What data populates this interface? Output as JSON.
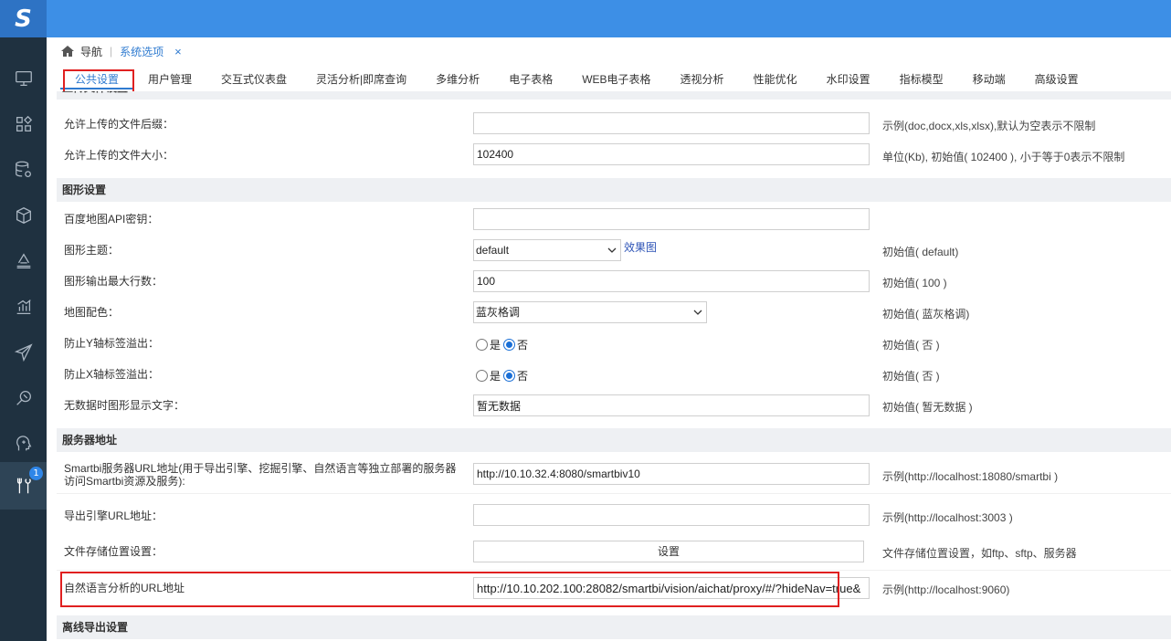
{
  "app": {
    "logo_glyph": "S",
    "colors": {
      "topbar": "#3d8fe6",
      "sidebar": "#1f3140",
      "accent": "#2f7bd0",
      "highlight": "#e02020"
    }
  },
  "sidebar": {
    "items": [
      {
        "icon": "monitor-icon"
      },
      {
        "icon": "widgets-icon"
      },
      {
        "icon": "database-settings-icon"
      },
      {
        "icon": "cube-icon"
      },
      {
        "icon": "layers-icon"
      },
      {
        "icon": "bar-chart-icon"
      },
      {
        "icon": "send-icon"
      },
      {
        "icon": "data-mining-icon"
      },
      {
        "icon": "brain-icon"
      },
      {
        "icon": "tools-icon",
        "badge": "1",
        "active": true
      }
    ]
  },
  "breadcrumb": {
    "home": "导航",
    "current": "系统选项",
    "close": "×"
  },
  "tabs": [
    "公共设置",
    "用户管理",
    "交互式仪表盘",
    "灵活分析|即席查询",
    "多维分析",
    "电子表格",
    "WEB电子表格",
    "透视分析",
    "性能优化",
    "水印设置",
    "指标模型",
    "移动端",
    "高级设置"
  ],
  "upload": {
    "cut_header": "上传文件设置",
    "suffix_label": "允许上传的文件后缀：",
    "suffix_value": "",
    "suffix_hint": "示例(doc,docx,xls,xlsx),默认为空表示不限制",
    "size_label": "允许上传的文件大小：",
    "size_value": "102400",
    "size_hint": "单位(Kb), 初始值( 102400 ), 小于等于0表示不限制"
  },
  "graphics": {
    "header": "图形设置",
    "baidu_label": "百度地图API密钥：",
    "baidu_value": "",
    "theme_label": "图形主题：",
    "theme_value": "default",
    "theme_link": "效果图",
    "theme_hint": "初始值( default)",
    "maxrows_label": "图形输出最大行数：",
    "maxrows_value": "100",
    "maxrows_hint": "初始值( 100 )",
    "mapcolor_label": "地图配色：",
    "mapcolor_value": "蓝灰格调",
    "mapcolor_hint": "初始值( 蓝灰格调)",
    "yaxis_label": "防止Y轴标签溢出：",
    "xaxis_label": "防止X轴标签溢出：",
    "yes": "是",
    "no": "否",
    "axis_hint": "初始值( 否 )",
    "nodata_label": "无数据时图形显示文字：",
    "nodata_value": "暂无数据",
    "nodata_hint": "初始值( 暂无数据 )"
  },
  "server": {
    "header": "服务器地址",
    "smartbi_label": "Smartbi服务器URL地址(用于导出引擎、挖掘引擎、自然语言等独立部署的服务器访问Smartbi资源及服务):",
    "smartbi_value": "http://10.10.32.4:8080/smartbiv10",
    "smartbi_hint": "示例(http://localhost:18080/smartbi )",
    "export_label": "导出引擎URL地址：",
    "export_value": "",
    "export_hint": "示例(http://localhost:3003 )",
    "storage_label": "文件存储位置设置：",
    "storage_button": "设置",
    "storage_hint": "文件存储位置设置，如ftp、sftp、服务器",
    "nl_label": "自然语言分析的URL地址",
    "nl_value": "http://10.10.202.100:28082/smartbi/vision/aichat/proxy/#/?hideNav=true&",
    "nl_hint": "示例(http://localhost:9060)"
  },
  "offline": {
    "header": "离线导出设置"
  }
}
